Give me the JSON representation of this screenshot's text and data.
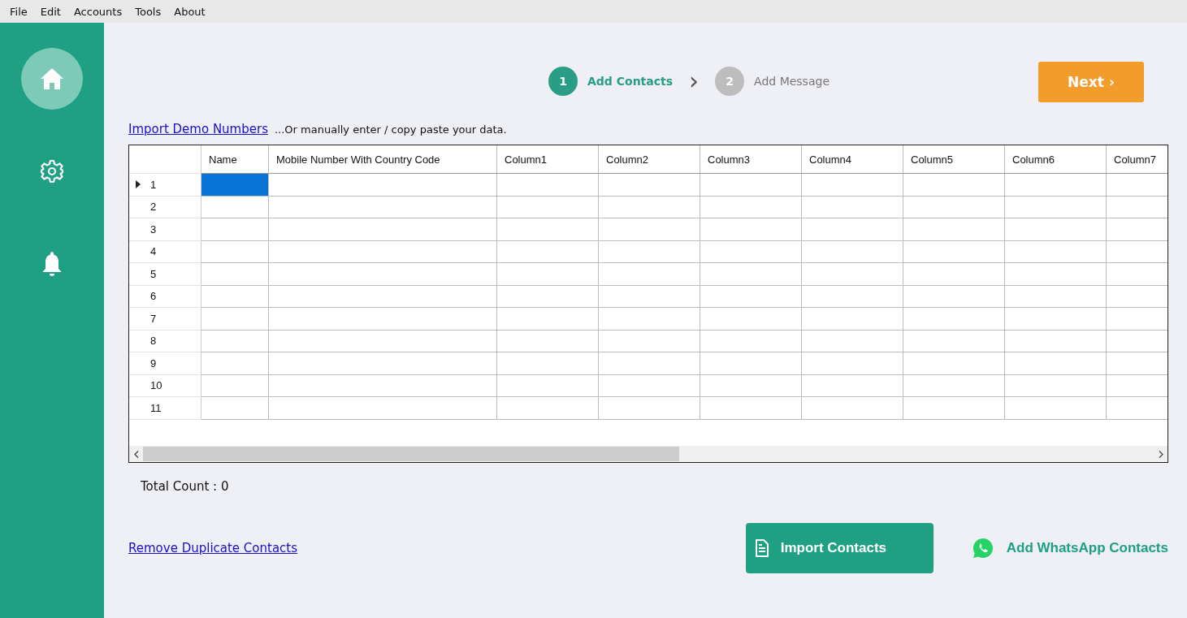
{
  "menu": [
    "File",
    "Edit",
    "Accounts",
    "Tools",
    "About"
  ],
  "sidebar": {
    "items": [
      {
        "kind": "home",
        "selected": true
      },
      {
        "kind": "settings",
        "selected": false
      },
      {
        "kind": "bell",
        "selected": false
      }
    ]
  },
  "steps": [
    {
      "number": "1",
      "label": "Add Contacts",
      "selected": true
    },
    {
      "number": "2",
      "label": "Add Message",
      "selected": false
    }
  ],
  "step_separator": "›",
  "next_button": "Next ›",
  "import_demo_link": "Import Demo Numbers",
  "import_hint": "...Or manually enter / copy paste your data.",
  "table": {
    "columns": [
      "Name",
      "Mobile Number With Country Code",
      "Column1",
      "Column2",
      "Column3",
      "Column4",
      "Column5",
      "Column6",
      "Column7"
    ],
    "rows": [
      {
        "number": "1",
        "current": true
      },
      {
        "number": "2",
        "current": false
      },
      {
        "number": "3",
        "current": false
      },
      {
        "number": "4",
        "current": false
      },
      {
        "number": "5",
        "current": false
      },
      {
        "number": "6",
        "current": false
      },
      {
        "number": "7",
        "current": false
      },
      {
        "number": "8",
        "current": false
      },
      {
        "number": "9",
        "current": false
      },
      {
        "number": "10",
        "current": false
      },
      {
        "number": "11",
        "current": false
      }
    ]
  },
  "total_count": "Total Count :  0",
  "remove_duplicates_link": "Remove Duplicate Contacts",
  "import_contacts_button": "Import Contacts",
  "add_whatsapp_button": "Add WhatsApp Contacts"
}
